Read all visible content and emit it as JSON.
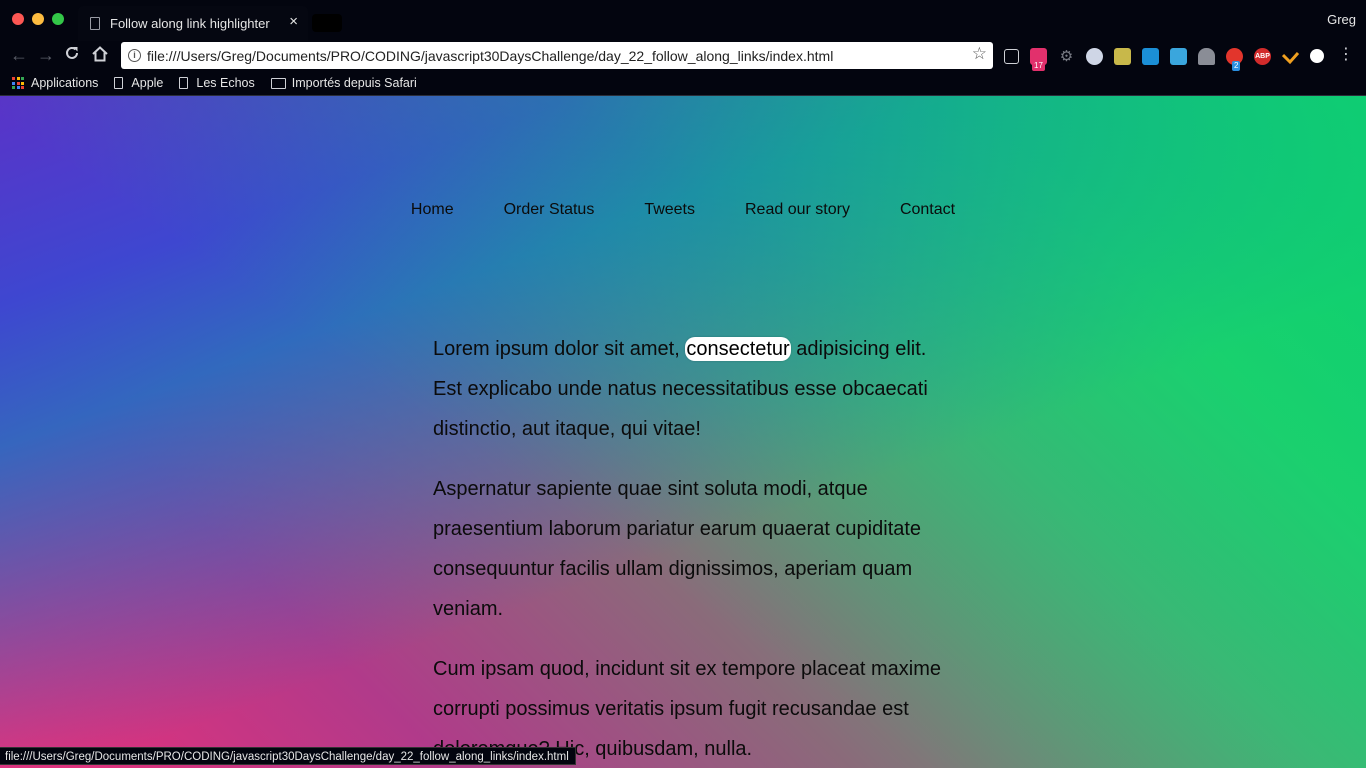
{
  "window": {
    "profile_name": "Greg"
  },
  "tab": {
    "title": "Follow along link highlighter",
    "close_glyph": "×"
  },
  "toolbar": {
    "url": "file:///Users/Greg/Documents/PRO/CODING/javascript30DaysChallenge/day_22_follow_along_links/index.html",
    "extension_badges": {
      "calendar": "17",
      "counter": "2",
      "adblock": "ABP"
    }
  },
  "bookmarks": [
    {
      "label": "Applications",
      "icon": "apps-grid-icon"
    },
    {
      "label": "Apple",
      "icon": "page-icon"
    },
    {
      "label": "Les Echos",
      "icon": "page-icon"
    },
    {
      "label": "Importés depuis Safari",
      "icon": "folder-icon"
    }
  ],
  "page": {
    "nav": [
      "Home",
      "Order Status",
      "Tweets",
      "Read our story",
      "Contact"
    ],
    "paragraphs": {
      "p1_before": "Lorem ipsum dolor sit amet, ",
      "p1_highlight": "consectetur",
      "p1_after": " adipisicing elit. Est explicabo unde natus necessitatibus esse obcaecati distinctio, aut itaque, qui vitae!",
      "p2": "Aspernatur sapiente quae sint soluta modi, atque praesentium laborum pariatur earum quaerat cupiditate consequuntur facilis ullam dignissimos, aperiam quam veniam.",
      "p3": "Cum ipsam quod, incidunt sit ex tempore placeat maxime corrupti possimus veritatis ipsum fugit recusandae est doloremque? Hic, quibusdam, nulla."
    }
  },
  "status_bar": {
    "text": "file:///Users/Greg/Documents/PRO/CODING/javascript30DaysChallenge/day_22_follow_along_links/index.html"
  },
  "colors": {
    "gradient_top_left": "#5a33c8",
    "gradient_bottom_left": "#e8307a",
    "gradient_right": "#0fd36e",
    "highlight_bg": "#ffffff"
  }
}
